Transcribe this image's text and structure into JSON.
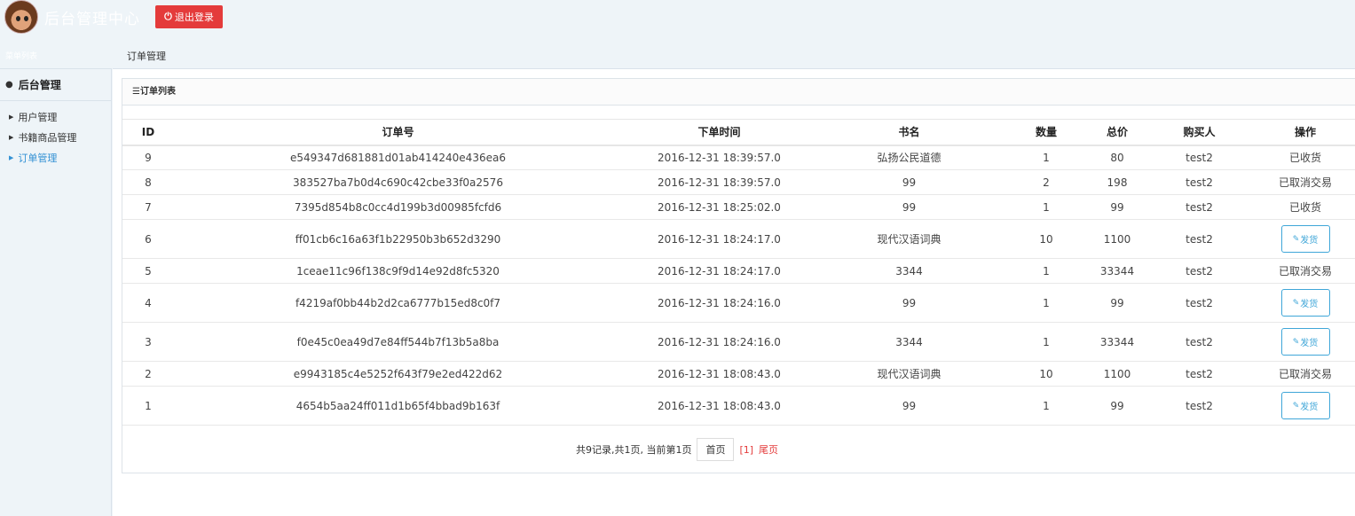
{
  "header": {
    "app_title": "后台管理中心",
    "logout_label": "退出登录"
  },
  "sidebar": {
    "head_label": "菜单列表",
    "group_label": "后台管理",
    "items": [
      {
        "label": "用户管理",
        "active": false
      },
      {
        "label": "书籍商品管理",
        "active": false
      },
      {
        "label": "订单管理",
        "active": true
      }
    ]
  },
  "breadcrumb": "订单管理",
  "panel": {
    "title": "订单列表"
  },
  "table": {
    "headers": [
      "ID",
      "订单号",
      "下单时间",
      "书名",
      "数量",
      "总价",
      "购买人",
      "操作"
    ],
    "rows": [
      {
        "id": "9",
        "order_no": "e549347d681881d01ab414240e436ea6",
        "time": "2016-12-31 18:39:57.0",
        "book": "弘扬公民道德",
        "qty": "1",
        "total": "80",
        "buyer": "test2",
        "action": "已收货",
        "is_button": false
      },
      {
        "id": "8",
        "order_no": "383527ba7b0d4c690c42cbe33f0a2576",
        "time": "2016-12-31 18:39:57.0",
        "book": "99",
        "qty": "2",
        "total": "198",
        "buyer": "test2",
        "action": "已取消交易",
        "is_button": false
      },
      {
        "id": "7",
        "order_no": "7395d854b8c0cc4d199b3d00985fcfd6",
        "time": "2016-12-31 18:25:02.0",
        "book": "99",
        "qty": "1",
        "total": "99",
        "buyer": "test2",
        "action": "已收货",
        "is_button": false
      },
      {
        "id": "6",
        "order_no": "ff01cb6c16a63f1b22950b3b652d3290",
        "time": "2016-12-31 18:24:17.0",
        "book": "现代汉语词典",
        "qty": "10",
        "total": "1100",
        "buyer": "test2",
        "action": "发货",
        "is_button": true
      },
      {
        "id": "5",
        "order_no": "1ceae11c96f138c9f9d14e92d8fc5320",
        "time": "2016-12-31 18:24:17.0",
        "book": "3344",
        "qty": "1",
        "total": "33344",
        "buyer": "test2",
        "action": "已取消交易",
        "is_button": false
      },
      {
        "id": "4",
        "order_no": "f4219af0bb44b2d2ca6777b15ed8c0f7",
        "time": "2016-12-31 18:24:16.0",
        "book": "99",
        "qty": "1",
        "total": "99",
        "buyer": "test2",
        "action": "发货",
        "is_button": true
      },
      {
        "id": "3",
        "order_no": "f0e45c0ea49d7e84ff544b7f13b5a8ba",
        "time": "2016-12-31 18:24:16.0",
        "book": "3344",
        "qty": "1",
        "total": "33344",
        "buyer": "test2",
        "action": "发货",
        "is_button": true
      },
      {
        "id": "2",
        "order_no": "e9943185c4e5252f643f79e2ed422d62",
        "time": "2016-12-31 18:08:43.0",
        "book": "现代汉语词典",
        "qty": "10",
        "total": "1100",
        "buyer": "test2",
        "action": "已取消交易",
        "is_button": false
      },
      {
        "id": "1",
        "order_no": "4654b5aa24ff011d1b65f4bbad9b163f",
        "time": "2016-12-31 18:08:43.0",
        "book": "99",
        "qty": "1",
        "total": "99",
        "buyer": "test2",
        "action": "发货",
        "is_button": true
      }
    ]
  },
  "pager": {
    "summary": "共9记录,共1页, 当前第1页",
    "first_label": "首页",
    "current_label": "[1]",
    "last_label": "尾页"
  },
  "colors": {
    "accent": "#3fa6d8",
    "danger": "#e43b3b",
    "background": "#eef4f8"
  },
  "icons": {
    "logout": "power-icon",
    "group": "user-icon",
    "list": "list-icon",
    "ship": "edit-icon"
  }
}
